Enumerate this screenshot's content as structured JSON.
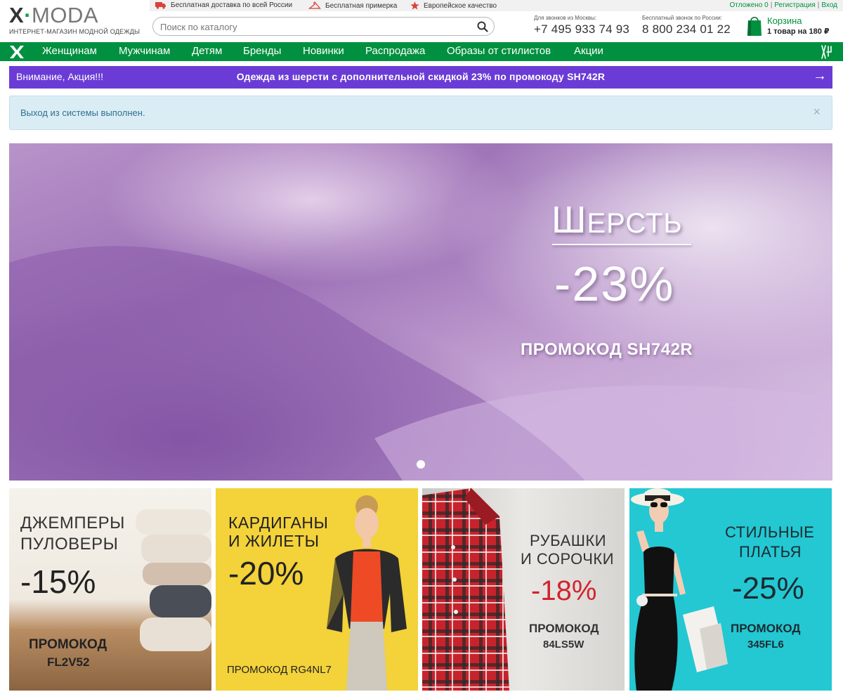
{
  "header": {
    "logo_x": "X",
    "logo_dot": "·",
    "logo_moda": "MODA",
    "logo_sub": "ИНТЕРНЕТ-МАГАЗИН МОДНОЙ ОДЕЖДЫ",
    "perks": [
      {
        "icon": "truck-icon",
        "label": "Бесплатная доставка по всей России"
      },
      {
        "icon": "hanger-icon",
        "label": "Бесплатная примерка"
      },
      {
        "icon": "star-icon",
        "label": "Европейское качество"
      }
    ],
    "account": {
      "saved": "Отложено 0",
      "register": "Регистрация",
      "login": "Вход"
    },
    "search": {
      "placeholder": "Поиск по каталогу"
    },
    "phones": [
      {
        "label": "Для звонков из Москвы:",
        "number": "+7 495 933 74 93"
      },
      {
        "label": "Бесплатный звонок по России:",
        "number": "8 800 234 01 22"
      }
    ],
    "cart": {
      "title": "Корзина",
      "info": "1 товар на 180 ₽"
    }
  },
  "nav": {
    "items": [
      "Женщинам",
      "Мужчинам",
      "Детям",
      "Бренды",
      "Новинки",
      "Распродажа",
      "Образы от стилистов",
      "Акции"
    ]
  },
  "promo": {
    "label": "Внимание, Акция!!!",
    "text": "Одежда из шерсти с дополнительной скидкой 23% по промокоду SH742R",
    "arrow": "→"
  },
  "alert": {
    "text": "Выход из системы выполнен.",
    "close": "×"
  },
  "hero": {
    "title_first": "Ш",
    "title_rest": "ЕРСТЬ",
    "discount": "-23%",
    "code": "ПРОМОКОД SH742R"
  },
  "tiles": [
    {
      "line1": "ДЖЕМПЕРЫ",
      "line2": "ПУЛОВЕРЫ",
      "discount": "-15%",
      "code_label": "ПРОМОКОД",
      "code": "FL2V52"
    },
    {
      "line1": "КАРДИГАНЫ",
      "line2": "И ЖИЛЕТЫ",
      "discount": "-20%",
      "code": "ПРОМОКОД RG4NL7"
    },
    {
      "line1": "РУБАШКИ",
      "line2": "И СОРОЧКИ",
      "discount": "-18%",
      "code_label": "ПРОМОКОД",
      "code": "84LS5W"
    },
    {
      "line1": "СТИЛЬНЫЕ",
      "line2": "ПЛАТЬЯ",
      "discount": "-25%",
      "code_label": "ПРОМОКОД",
      "code": "345FL6"
    }
  ],
  "colors": {
    "brand_green": "#00903f",
    "promo_purple": "#6b3bd6",
    "alert_bg": "#daedf5",
    "tile2_bg": "#f3d23a",
    "tile4_bg": "#23c8d3"
  }
}
